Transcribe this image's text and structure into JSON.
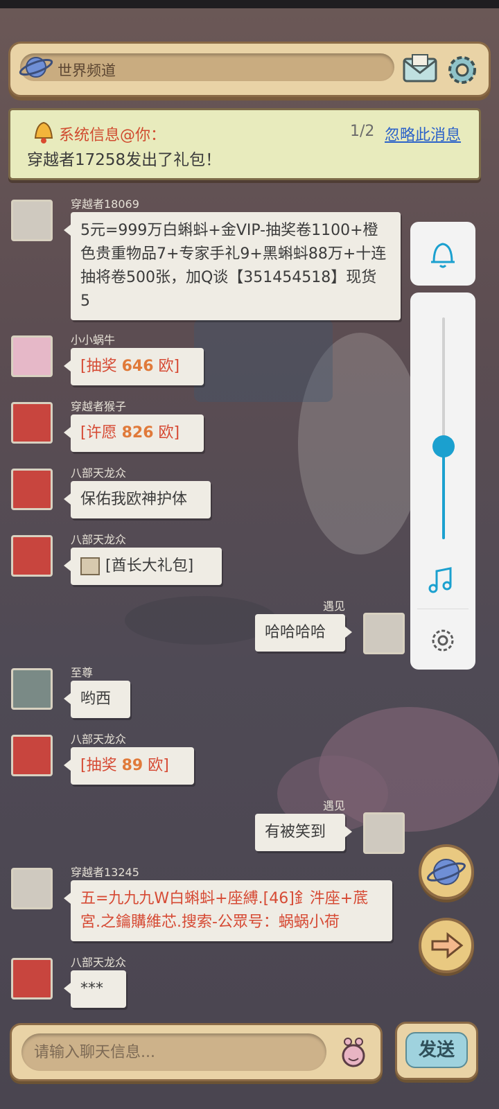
{
  "header": {
    "channel_label": "世界频道"
  },
  "system_notice": {
    "title": "系统信息@你：",
    "count": "1/2",
    "ignore_label": "忽略此消息",
    "message": "穿越者17258发出了礼包！"
  },
  "messages": [
    {
      "name": "穿越者18069",
      "text": "5元=999万白蝌蚪+金VIP-抽奖卷1100+橙色贵重物品7+专家手礼9+黑蝌蚪88万+十连抽将卷500张，加Q谈【351454518】现货 5"
    },
    {
      "name": "小小蜗牛",
      "prefix": "[抽奖 ",
      "number": "646",
      "suffix": " 欧]"
    },
    {
      "name": "穿越者猴子",
      "prefix": "[许愿 ",
      "number": "826",
      "suffix": " 欧]"
    },
    {
      "name": "八部天龙众",
      "text": "保佑我欧神护体"
    },
    {
      "name": "八部天龙众",
      "text": "[酋长大礼包]"
    },
    {
      "name": "遇见",
      "text": "哈哈哈哈"
    },
    {
      "name": "至尊",
      "text": "哟西"
    },
    {
      "name": "八部天龙众",
      "prefix": "[抽奖 ",
      "number": "89",
      "suffix": " 欧]"
    },
    {
      "name": "遇见",
      "text": "有被笑到"
    },
    {
      "name": "穿越者13245",
      "text": "五=九九九W白蝌蚪+座縛.[46]釒汼座+菧宮.之鑰購維芯.搜索-公眾号：蜗蜗小荷"
    },
    {
      "name": "八部天龙众",
      "text": "***"
    }
  ],
  "volume_panel": {
    "level": 0.42
  },
  "input": {
    "placeholder": "请输入聊天信息..."
  },
  "send_label": "发送"
}
